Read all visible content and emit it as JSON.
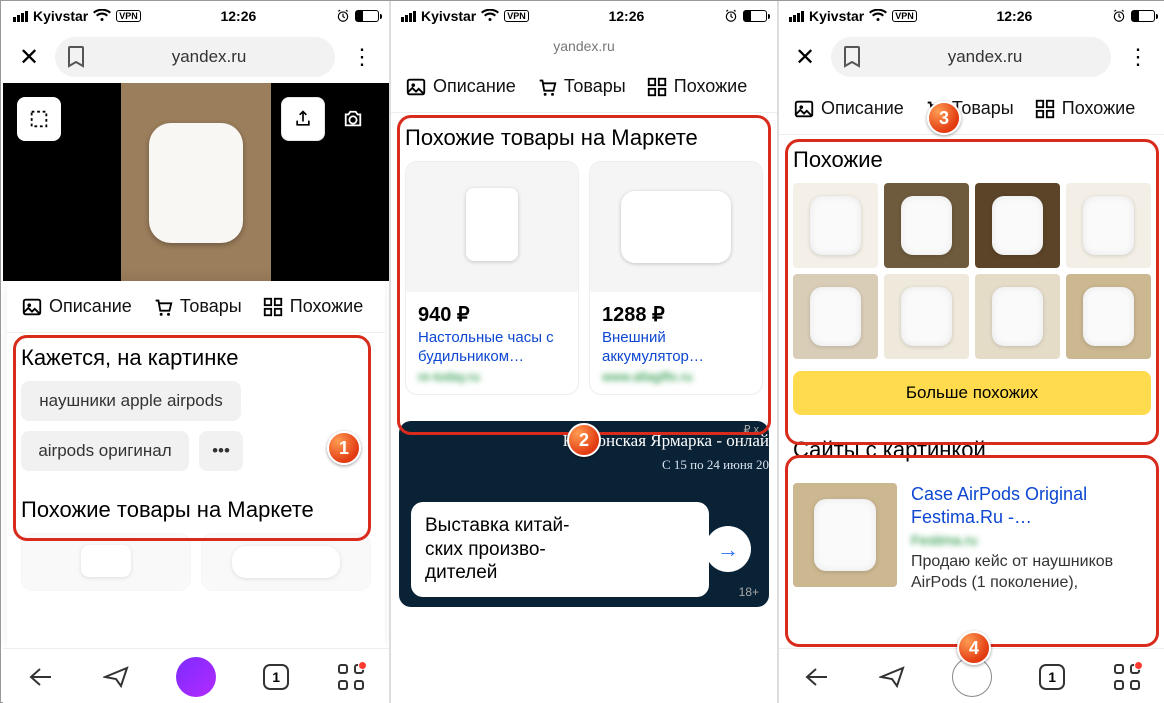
{
  "status": {
    "carrier": "Kyivstar",
    "vpn": "VPN",
    "time": "12:26"
  },
  "toolbar": {
    "url": "yandex.ru"
  },
  "tabs": {
    "desc": "Описание",
    "goods": "Товары",
    "similar": "Похожие"
  },
  "p1": {
    "guess_title": "Кажется, на картинке",
    "guesses": [
      "наушники apple airpods",
      "airpods оригинал"
    ],
    "market_title": "Похожие товары на Маркете"
  },
  "p2": {
    "market_title": "Похожие товары на Маркете",
    "items": [
      {
        "price": "940 ₽",
        "name": "Настольные часы с будильником…",
        "shop": "re-today.ru"
      },
      {
        "price": "1288 ₽",
        "name": "Внешний аккумулятор…",
        "shop": "www.allagifts.ru"
      }
    ],
    "ad": {
      "tag": "₽ х",
      "headline": "Кантонская Ярмарка - онлай",
      "dates": "С 15 по 24 июня 20",
      "card": "Выставка китай-\nских произво-\nдителей",
      "age": "18+"
    }
  },
  "p3": {
    "similar_title": "Похожие",
    "more_btn": "Больше похожих",
    "sites_title": "Сайты с картинкой",
    "site": {
      "link": "Case AirPods Original Festima.Ru -…",
      "src": "Festima.ru",
      "desc": "Продаю кейс от наушников AirPods (1 поколение),"
    }
  },
  "nav": {
    "tabs": "1"
  }
}
